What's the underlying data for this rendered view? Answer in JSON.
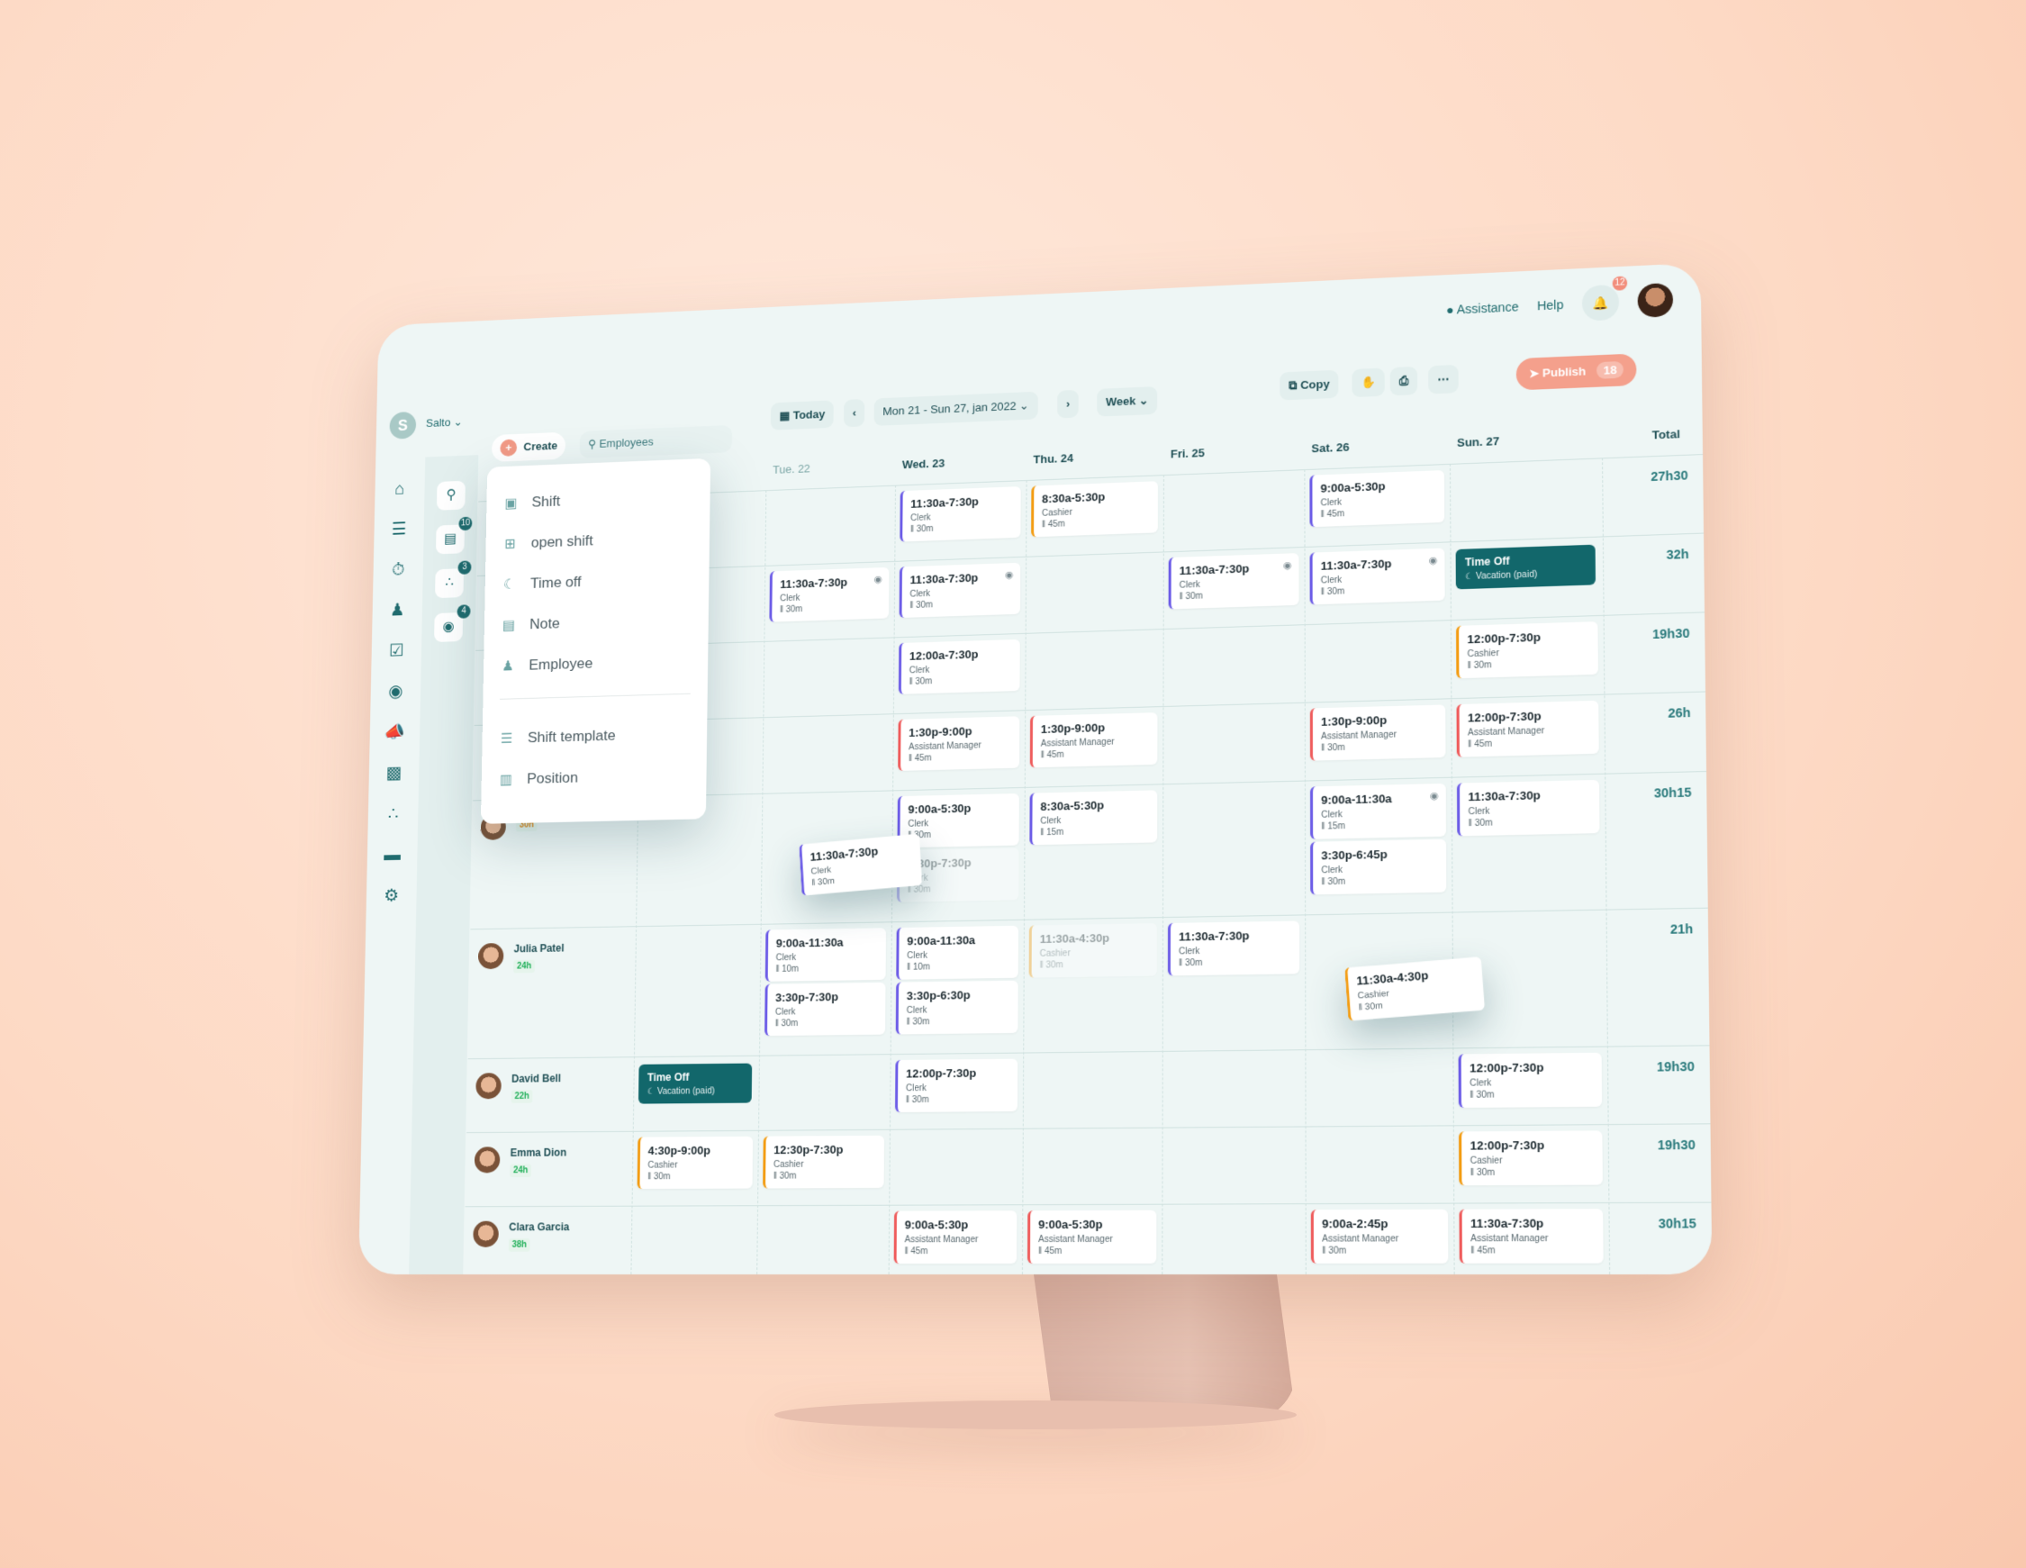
{
  "topbar": {
    "assistance": "Assistance",
    "help": "Help",
    "notifications": "12"
  },
  "toolbar": {
    "logo": "S",
    "org": "Salto",
    "create": "Create",
    "search_placeholder": "Employees",
    "today": "Today",
    "date_range": "Mon 21 - Sun 27, jan 2022",
    "view": "Week",
    "copy": "Copy",
    "publish": "Publish",
    "publish_count": "18"
  },
  "rail2_badges": [
    "10",
    "3",
    "4"
  ],
  "days": [
    {
      "label": ""
    },
    {
      "label": "Tue. 22",
      "muted": true
    },
    {
      "label": "Wed. 23"
    },
    {
      "label": "Thu. 24"
    },
    {
      "label": "Fri. 25"
    },
    {
      "label": "Sat. 26"
    },
    {
      "label": "Sun. 27"
    }
  ],
  "total_label": "Total",
  "menu": {
    "items": [
      {
        "label": "Shift",
        "icon": "shift-icon"
      },
      {
        "label": "open shift",
        "icon": "calendar-plus-icon"
      },
      {
        "label": "Time off",
        "icon": "moon-icon"
      },
      {
        "label": "Note",
        "icon": "note-icon"
      },
      {
        "label": "Employee",
        "icon": "user-plus-icon"
      }
    ],
    "items2": [
      {
        "label": "Shift template",
        "icon": "template-icon"
      },
      {
        "label": "Position",
        "icon": "badge-icon"
      }
    ]
  },
  "colors": {
    "clerk": "#6c5ce7",
    "cashier": "#f39c12",
    "manager": "#ef5b5b",
    "timeoff": "#12676b",
    "accent": "#f4a08c"
  },
  "rows": [
    {
      "total": "27h30",
      "shifts": [
        {
          "d": 2,
          "t": "11:30a-7:30p",
          "p": "Clerk",
          "b": "30m",
          "c": "clerk"
        },
        {
          "d": 3,
          "t": "8:30a-5:30p",
          "p": "Cashier",
          "b": "45m",
          "c": "cashier"
        },
        {
          "d": 5,
          "t": "9:00a-5:30p",
          "p": "Clerk",
          "b": "45m",
          "c": "clerk"
        }
      ]
    },
    {
      "total": "32h",
      "shifts": [
        {
          "d": 1,
          "t": "11:30a-7:30p",
          "p": "Clerk",
          "b": "30m",
          "c": "clerk",
          "eye": true
        },
        {
          "d": 2,
          "t": "11:30a-7:30p",
          "p": "Clerk",
          "b": "30m",
          "c": "clerk",
          "eye": true
        },
        {
          "d": 4,
          "t": "11:30a-7:30p",
          "p": "Clerk",
          "b": "30m",
          "c": "clerk",
          "eye": true
        },
        {
          "d": 5,
          "t": "11:30a-7:30p",
          "p": "Clerk",
          "b": "30m",
          "c": "clerk",
          "eye": true
        }
      ],
      "timeoff": {
        "d": 6,
        "title": "Time Off",
        "sub": "Vacation (paid)"
      }
    },
    {
      "total": "19h30",
      "shifts": [
        {
          "d": 2,
          "t": "12:00a-7:30p",
          "p": "Clerk",
          "b": "30m",
          "c": "clerk"
        },
        {
          "d": 6,
          "t": "12:00p-7:30p",
          "p": "Cashier",
          "b": "30m",
          "c": "cashier"
        }
      ]
    },
    {
      "total": "26h",
      "shifts": [
        {
          "d": 2,
          "t": "1:30p-9:00p",
          "p": "Assistant Manager",
          "b": "45m",
          "c": "manager"
        },
        {
          "d": 3,
          "t": "1:30p-9:00p",
          "p": "Assistant Manager",
          "b": "45m",
          "c": "manager"
        },
        {
          "d": 5,
          "t": "1:30p-9:00p",
          "p": "Assistant Manager",
          "b": "30m",
          "c": "manager"
        },
        {
          "d": 6,
          "t": "12:00p-7:30p",
          "p": "Assistant Manager",
          "b": "45m",
          "c": "manager"
        }
      ]
    },
    {
      "total": "30h15",
      "hours": "30h",
      "shifts": [
        {
          "d": 2,
          "t": "9:00a-5:30p",
          "p": "Clerk",
          "b": "30m",
          "c": "clerk"
        },
        {
          "d": 2,
          "t": "3:30p-7:30p",
          "p": "Clerk",
          "b": "30m",
          "c": "clerk",
          "slot": 1,
          "ghost": true
        },
        {
          "d": 3,
          "t": "8:30a-5:30p",
          "p": "Clerk",
          "b": "15m",
          "c": "clerk"
        },
        {
          "d": 5,
          "t": "9:00a-11:30a",
          "p": "Clerk",
          "b": "15m",
          "c": "clerk",
          "eye": true
        },
        {
          "d": 5,
          "t": "3:30p-6:45p",
          "p": "Clerk",
          "b": "30m",
          "c": "clerk",
          "slot": 1
        },
        {
          "d": 6,
          "t": "11:30a-7:30p",
          "p": "Clerk",
          "b": "30m",
          "c": "clerk"
        },
        {
          "d": 1,
          "t": "11:30a-7:30p",
          "p": "Clerk",
          "b": "30m",
          "c": "clerk",
          "drag": true
        }
      ]
    },
    {
      "name": "Julia Patel",
      "hours": "24h",
      "total": "21h",
      "shifts": [
        {
          "d": 1,
          "t": "9:00a-11:30a",
          "p": "Clerk",
          "b": "10m",
          "c": "clerk"
        },
        {
          "d": 1,
          "t": "3:30p-7:30p",
          "p": "Clerk",
          "b": "30m",
          "c": "clerk",
          "slot": 1
        },
        {
          "d": 2,
          "t": "9:00a-11:30a",
          "p": "Clerk",
          "b": "10m",
          "c": "clerk"
        },
        {
          "d": 2,
          "t": "3:30p-6:30p",
          "p": "Clerk",
          "b": "30m",
          "c": "clerk",
          "slot": 1
        },
        {
          "d": 3,
          "t": "11:30a-4:30p",
          "p": "Cashier",
          "b": "30m",
          "c": "cashier",
          "ghost": true
        },
        {
          "d": 4,
          "t": "11:30a-7:30p",
          "p": "Clerk",
          "b": "30m",
          "c": "clerk"
        },
        {
          "d": 5,
          "t": "11:30a-4:30p",
          "p": "Cashier",
          "b": "30m",
          "c": "cashier",
          "drag": true
        }
      ]
    },
    {
      "name": "David Bell",
      "hours": "22h",
      "total": "19h30",
      "shifts": [
        {
          "d": 2,
          "t": "12:00p-7:30p",
          "p": "Clerk",
          "b": "30m",
          "c": "clerk"
        },
        {
          "d": 6,
          "t": "12:00p-7:30p",
          "p": "Clerk",
          "b": "30m",
          "c": "clerk"
        }
      ],
      "timeoff": {
        "d": 0,
        "title": "Time Off",
        "sub": "Vacation (paid)"
      }
    },
    {
      "name": "Emma Dion",
      "hours": "24h",
      "total": "19h30",
      "shifts": [
        {
          "d": 0,
          "t": "4:30p-9:00p",
          "p": "Cashier",
          "b": "30m",
          "c": "cashier"
        },
        {
          "d": 1,
          "t": "12:30p-7:30p",
          "p": "Cashier",
          "b": "30m",
          "c": "cashier"
        },
        {
          "d": 6,
          "t": "12:00p-7:30p",
          "p": "Cashier",
          "b": "30m",
          "c": "cashier"
        }
      ]
    },
    {
      "name": "Clara Garcia",
      "hours": "38h",
      "total": "30h15",
      "shifts": [
        {
          "d": 2,
          "t": "9:00a-5:30p",
          "p": "Assistant Manager",
          "b": "45m",
          "c": "manager"
        },
        {
          "d": 3,
          "t": "9:00a-5:30p",
          "p": "Assistant Manager",
          "b": "45m",
          "c": "manager"
        },
        {
          "d": 5,
          "t": "9:00a-2:45p",
          "p": "Assistant Manager",
          "b": "30m",
          "c": "manager"
        },
        {
          "d": 6,
          "t": "11:30a-7:30p",
          "p": "Assistant Manager",
          "b": "45m",
          "c": "manager"
        }
      ]
    }
  ]
}
